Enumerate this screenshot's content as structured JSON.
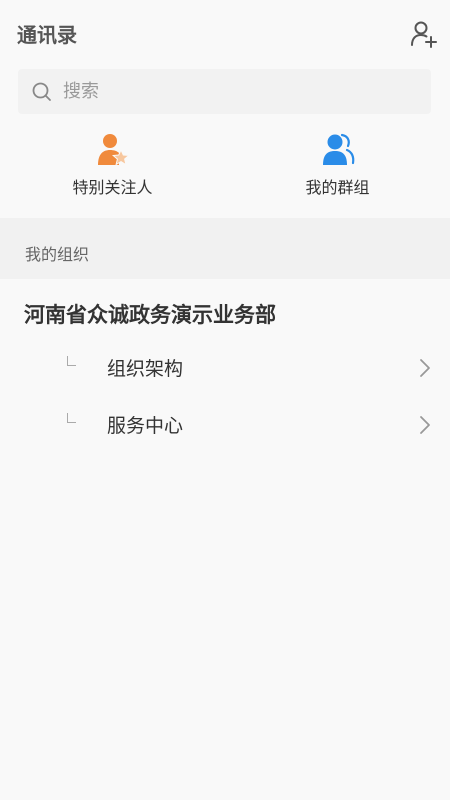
{
  "header": {
    "title": "通讯录",
    "add_icon": "add-contact-icon"
  },
  "search": {
    "placeholder": "搜索",
    "icon": "search-icon"
  },
  "quick_links": [
    {
      "label": "特别关注人",
      "icon": "special-follow-icon",
      "color": "#f08a3c"
    },
    {
      "label": "我的群组",
      "icon": "group-icon",
      "color": "#2a8ce8"
    }
  ],
  "section": {
    "label": "我的组织"
  },
  "org": {
    "name": "河南省众诚政务演示业务部",
    "children": [
      {
        "label": "组织架构"
      },
      {
        "label": "服务中心"
      }
    ]
  },
  "colors": {
    "background": "#f9f9f9",
    "band": "#f1f1f1",
    "text": "#333333",
    "muted": "#9a9a9a"
  }
}
